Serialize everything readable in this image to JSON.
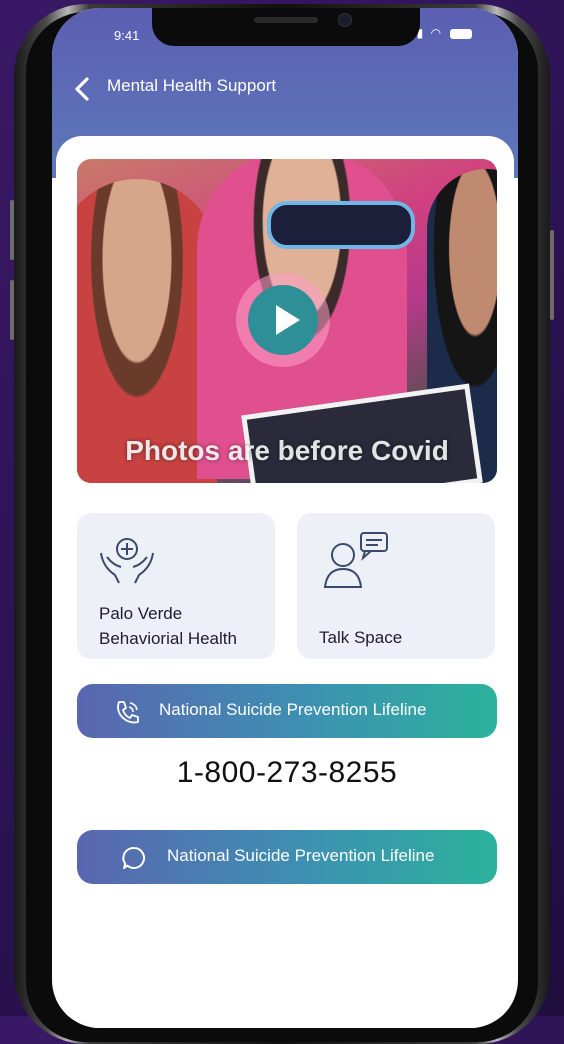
{
  "status_bar": {
    "time": "9:41"
  },
  "header": {
    "title": "Mental Health Support",
    "back_icon": "chevron-left-icon"
  },
  "video": {
    "caption": "Photos are before Covid",
    "play_icon": "play-icon"
  },
  "resources": [
    {
      "label": "Palo Verde\nBehaviorial Health",
      "icon": "hands-heart-icon"
    },
    {
      "label": "Talk Space",
      "icon": "person-chat-icon"
    }
  ],
  "hotline": {
    "call_label": "National Suicide Prevention Lifeline",
    "call_icon": "phone-call-icon",
    "number": "1-800-273-8255",
    "chat_label": "National Suicide Prevention Lifeline",
    "chat_icon": "chat-bubble-icon"
  },
  "colors": {
    "header_gradient": [
      "#5b5fb2",
      "#5d78ba"
    ],
    "cta_gradient": [
      "#5a66b0",
      "#2cb29b"
    ],
    "tile_bg": "#eef0f8",
    "play_button": "#2f8f96"
  }
}
